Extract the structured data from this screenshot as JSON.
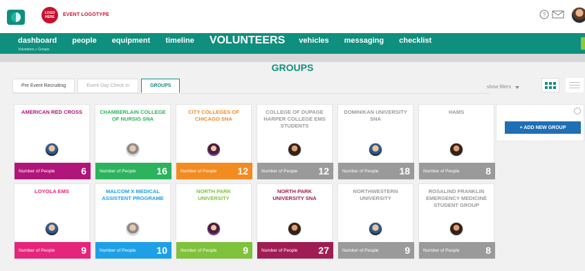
{
  "header": {
    "event_logo_text": "LOGO HERE",
    "event_title": "EVENT LOGOTYPE",
    "icons": [
      "help-icon",
      "mail-icon"
    ]
  },
  "nav": {
    "items": [
      "dashboard",
      "people",
      "equipment",
      "timeline",
      "VOLUNTEERS",
      "vehicles",
      "messaging",
      "checklist"
    ],
    "active_index": 4,
    "breadcrumb": "Volunteers » Groups"
  },
  "page": {
    "title": "GROUPS"
  },
  "tabs": [
    {
      "label": "Pre Event Recruiting",
      "state": "normal"
    },
    {
      "label": "Event Day Check In",
      "state": "muted"
    },
    {
      "label": "GROUPS",
      "state": "active"
    }
  ],
  "filters": {
    "label": "show filters"
  },
  "panel": {
    "add_group_label": "+ ADD NEW GROUP"
  },
  "cards": [
    {
      "name": "AMERICAN RED CROSS",
      "count": 6,
      "color": "#b0157a",
      "avatar": "man-blue"
    },
    {
      "name": "CHAMBERLAIN COLLEGE OF NURSIG SNA",
      "count": 16,
      "color": "#2db35d",
      "avatar": "man-gray"
    },
    {
      "name": "CITY COLLEGES OF CHICAGO SNA",
      "count": 12,
      "color": "#f28b20",
      "avatar": "woman-purple"
    },
    {
      "name": "COLLEGE OF DUPAGE HARPER COLLEGE EMS STUDENTS",
      "count": 12,
      "color": "#9a9a9a",
      "avatar": "woman-dark"
    },
    {
      "name": "DOMINIKAN UNIVERSITY SNA",
      "count": 18,
      "color": "#9a9a9a",
      "avatar": "man-blue"
    },
    {
      "name": "HAMS",
      "count": 8,
      "color": "#9a9a9a",
      "avatar": "woman-dark"
    },
    {
      "name": "LOYOLA EMS",
      "count": 9,
      "color": "#e6247a",
      "avatar": "man-blue"
    },
    {
      "name": "MALCOM X MEDICAL ASSISTENT PROGRAME",
      "count": 10,
      "color": "#1ea0e6",
      "avatar": "man-gray"
    },
    {
      "name": "NORTH PARK UNIVERSITY",
      "count": 9,
      "color": "#7fc23b",
      "avatar": "woman-purple"
    },
    {
      "name": "NORTH PARK UNIVERSITY SNA",
      "count": 27,
      "color": "#9f1d52",
      "avatar": "woman-dark"
    },
    {
      "name": "NORTHWESTERN UNIVERSITY",
      "count": 9,
      "color": "#9a9a9a",
      "avatar": "man-blue"
    },
    {
      "name": "ROSALIND FRANKLIN EMERGENCY MEDICINE STUDENT GROUP",
      "count": 8,
      "color": "#9a9a9a",
      "avatar": "woman-dark"
    }
  ],
  "card_footer_label": "Number of People"
}
